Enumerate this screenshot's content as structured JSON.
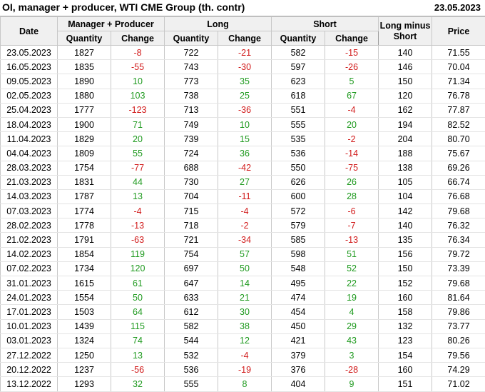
{
  "header": {
    "title": "OI, manager + producer, WTI CME Group (th. contr)",
    "date": "23.05.2023"
  },
  "columns": {
    "date": "Date",
    "group_mp": "Manager + Producer",
    "group_long": "Long",
    "group_short": "Short",
    "long_minus_short": "Long minus Short",
    "price": "Price",
    "quantity": "Quantity",
    "change": "Change"
  },
  "colors": {
    "positive": "#1f9a1f",
    "negative": "#d11a1a",
    "header_bg": "#f0f0f0"
  },
  "rows": [
    {
      "date": "23.05.2023",
      "mp_qty": "1827",
      "mp_chg": "-8",
      "long_qty": "722",
      "long_chg": "-21",
      "short_qty": "582",
      "short_chg": "-15",
      "lms": "140",
      "price": "71.55"
    },
    {
      "date": "16.05.2023",
      "mp_qty": "1835",
      "mp_chg": "-55",
      "long_qty": "743",
      "long_chg": "-30",
      "short_qty": "597",
      "short_chg": "-26",
      "lms": "146",
      "price": "70.04"
    },
    {
      "date": "09.05.2023",
      "mp_qty": "1890",
      "mp_chg": "10",
      "long_qty": "773",
      "long_chg": "35",
      "short_qty": "623",
      "short_chg": "5",
      "lms": "150",
      "price": "71.34"
    },
    {
      "date": "02.05.2023",
      "mp_qty": "1880",
      "mp_chg": "103",
      "long_qty": "738",
      "long_chg": "25",
      "short_qty": "618",
      "short_chg": "67",
      "lms": "120",
      "price": "76.78"
    },
    {
      "date": "25.04.2023",
      "mp_qty": "1777",
      "mp_chg": "-123",
      "long_qty": "713",
      "long_chg": "-36",
      "short_qty": "551",
      "short_chg": "-4",
      "lms": "162",
      "price": "77.87",
      "sep": true
    },
    {
      "date": "18.04.2023",
      "mp_qty": "1900",
      "mp_chg": "71",
      "long_qty": "749",
      "long_chg": "10",
      "short_qty": "555",
      "short_chg": "20",
      "lms": "194",
      "price": "82.52"
    },
    {
      "date": "11.04.2023",
      "mp_qty": "1829",
      "mp_chg": "20",
      "long_qty": "739",
      "long_chg": "15",
      "short_qty": "535",
      "short_chg": "-2",
      "lms": "204",
      "price": "80.70"
    },
    {
      "date": "04.04.2023",
      "mp_qty": "1809",
      "mp_chg": "55",
      "long_qty": "724",
      "long_chg": "36",
      "short_qty": "536",
      "short_chg": "-14",
      "lms": "188",
      "price": "75.67"
    },
    {
      "date": "28.03.2023",
      "mp_qty": "1754",
      "mp_chg": "-77",
      "long_qty": "688",
      "long_chg": "-42",
      "short_qty": "550",
      "short_chg": "-75",
      "lms": "138",
      "price": "69.26",
      "sep": true
    },
    {
      "date": "21.03.2023",
      "mp_qty": "1831",
      "mp_chg": "44",
      "long_qty": "730",
      "long_chg": "27",
      "short_qty": "626",
      "short_chg": "26",
      "lms": "105",
      "price": "66.74"
    },
    {
      "date": "14.03.2023",
      "mp_qty": "1787",
      "mp_chg": "13",
      "long_qty": "704",
      "long_chg": "-11",
      "short_qty": "600",
      "short_chg": "28",
      "lms": "104",
      "price": "76.68"
    },
    {
      "date": "07.03.2023",
      "mp_qty": "1774",
      "mp_chg": "-4",
      "long_qty": "715",
      "long_chg": "-4",
      "short_qty": "572",
      "short_chg": "-6",
      "lms": "142",
      "price": "79.68"
    },
    {
      "date": "28.02.2023",
      "mp_qty": "1778",
      "mp_chg": "-13",
      "long_qty": "718",
      "long_chg": "-2",
      "short_qty": "579",
      "short_chg": "-7",
      "lms": "140",
      "price": "76.32",
      "sep": true
    },
    {
      "date": "21.02.2023",
      "mp_qty": "1791",
      "mp_chg": "-63",
      "long_qty": "721",
      "long_chg": "-34",
      "short_qty": "585",
      "short_chg": "-13",
      "lms": "135",
      "price": "76.34"
    },
    {
      "date": "14.02.2023",
      "mp_qty": "1854",
      "mp_chg": "119",
      "long_qty": "754",
      "long_chg": "57",
      "short_qty": "598",
      "short_chg": "51",
      "lms": "156",
      "price": "79.72"
    },
    {
      "date": "07.02.2023",
      "mp_qty": "1734",
      "mp_chg": "120",
      "long_qty": "697",
      "long_chg": "50",
      "short_qty": "548",
      "short_chg": "52",
      "lms": "150",
      "price": "73.39"
    },
    {
      "date": "31.01.2023",
      "mp_qty": "1615",
      "mp_chg": "61",
      "long_qty": "647",
      "long_chg": "14",
      "short_qty": "495",
      "short_chg": "22",
      "lms": "152",
      "price": "79.68"
    },
    {
      "date": "24.01.2023",
      "mp_qty": "1554",
      "mp_chg": "50",
      "long_qty": "633",
      "long_chg": "21",
      "short_qty": "474",
      "short_chg": "19",
      "lms": "160",
      "price": "81.64",
      "sep": true
    },
    {
      "date": "17.01.2023",
      "mp_qty": "1503",
      "mp_chg": "64",
      "long_qty": "612",
      "long_chg": "30",
      "short_qty": "454",
      "short_chg": "4",
      "lms": "158",
      "price": "79.86"
    },
    {
      "date": "10.01.2023",
      "mp_qty": "1439",
      "mp_chg": "115",
      "long_qty": "582",
      "long_chg": "38",
      "short_qty": "450",
      "short_chg": "29",
      "lms": "132",
      "price": "73.77"
    },
    {
      "date": "03.01.2023",
      "mp_qty": "1324",
      "mp_chg": "74",
      "long_qty": "544",
      "long_chg": "12",
      "short_qty": "421",
      "short_chg": "43",
      "lms": "123",
      "price": "80.26"
    },
    {
      "date": "27.12.2022",
      "mp_qty": "1250",
      "mp_chg": "13",
      "long_qty": "532",
      "long_chg": "-4",
      "short_qty": "379",
      "short_chg": "3",
      "lms": "154",
      "price": "79.56"
    },
    {
      "date": "20.12.2022",
      "mp_qty": "1237",
      "mp_chg": "-56",
      "long_qty": "536",
      "long_chg": "-19",
      "short_qty": "376",
      "short_chg": "-28",
      "lms": "160",
      "price": "74.29"
    },
    {
      "date": "13.12.2022",
      "mp_qty": "1293",
      "mp_chg": "32",
      "long_qty": "555",
      "long_chg": "8",
      "short_qty": "404",
      "short_chg": "9",
      "lms": "151",
      "price": "71.02"
    }
  ]
}
